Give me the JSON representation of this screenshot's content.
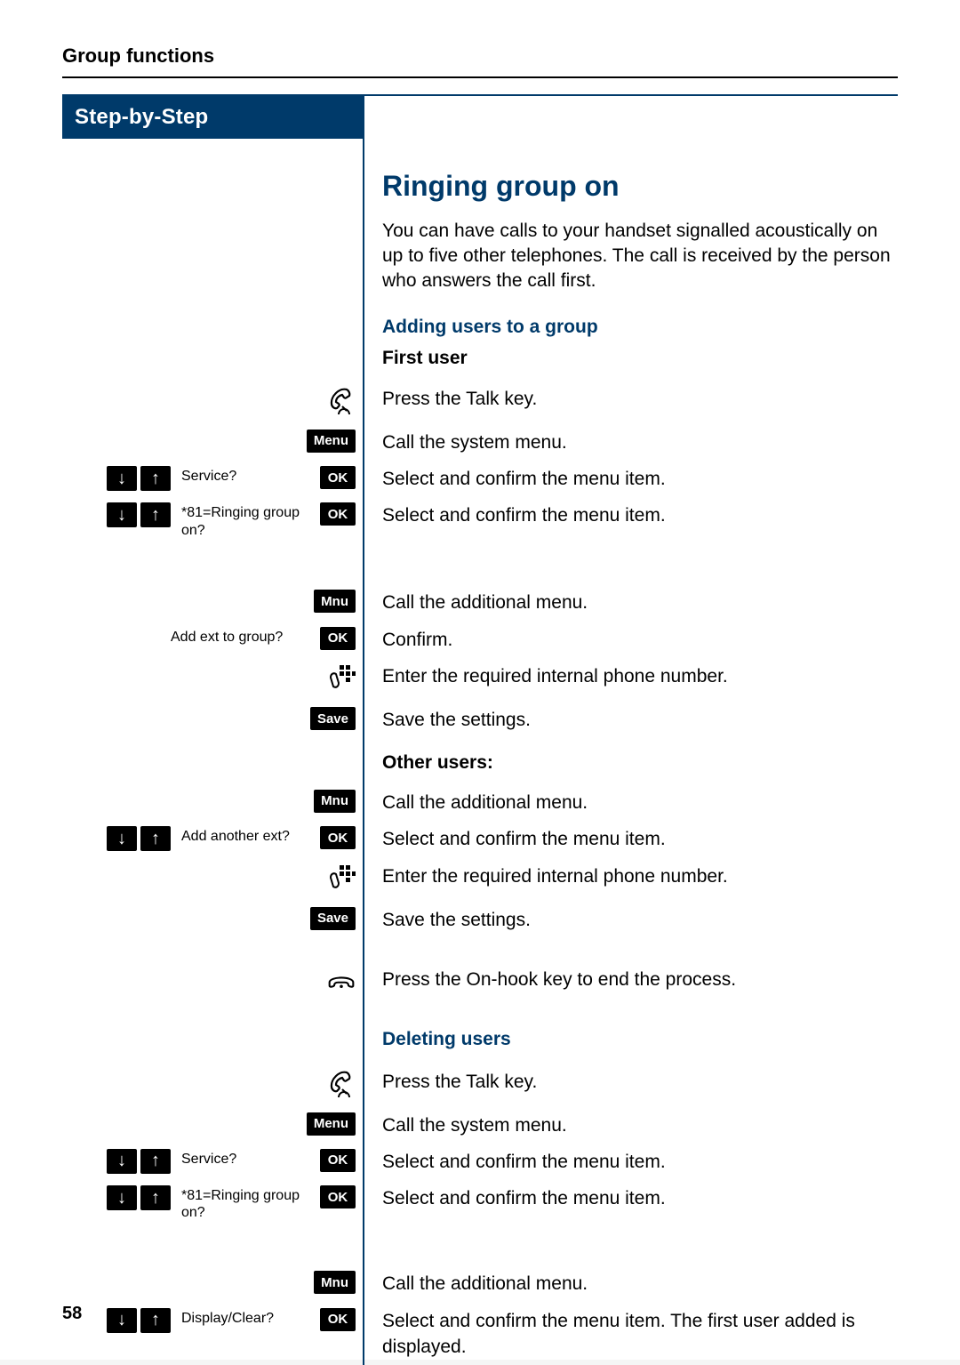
{
  "page": {
    "header": "Group functions",
    "step_banner": "Step-by-Step",
    "page_number": "58"
  },
  "labels": {
    "menu": "Menu",
    "ok": "OK",
    "mnu": "Mnu",
    "save": "Save"
  },
  "main": {
    "title": "Ringing group on",
    "intro": "You can have calls to your handset signalled acoustically on up to five other telephones. The call is received by the person who answers the call first.",
    "section_adding": "Adding users to a group",
    "first_user": "First user",
    "other_users": "Other users:",
    "section_deleting": "Deleting users"
  },
  "prompts": {
    "service": "Service?",
    "ringing_group": "*81=Ringing group on?",
    "add_ext": "Add ext to group?",
    "add_another": "Add another ext?",
    "display_clear": "Display/Clear?"
  },
  "instructions": {
    "press_talk": "Press the Talk key.",
    "call_system_menu": "Call the system menu.",
    "select_confirm": "Select and confirm the menu item.",
    "call_additional_menu": "Call the additional menu.",
    "confirm": "Confirm.",
    "enter_internal": "Enter the required internal phone number.",
    "save_settings": "Save the settings.",
    "press_onhook": "Press the On-hook key to end the process.",
    "select_confirm_first_user": "Select and confirm the menu item. The first user added is displayed."
  }
}
